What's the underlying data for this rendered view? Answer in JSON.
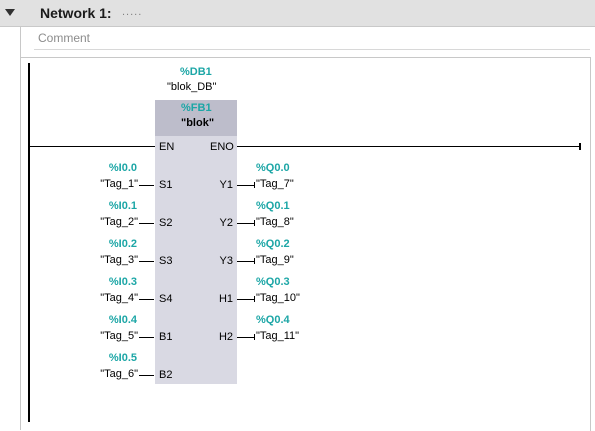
{
  "header": {
    "title": "Network 1:",
    "dots": "....."
  },
  "comment": {
    "placeholder": "Comment"
  },
  "block": {
    "instance_address": "%DB1",
    "instance_name": "\"blok_DB\"",
    "fb_address": "%FB1",
    "fb_name": "\"blok\"",
    "en": "EN",
    "eno": "ENO"
  },
  "inputs": [
    {
      "address": "%I0.0",
      "tag": "\"Tag_1\"",
      "pin": "S1"
    },
    {
      "address": "%I0.1",
      "tag": "\"Tag_2\"",
      "pin": "S2"
    },
    {
      "address": "%I0.2",
      "tag": "\"Tag_3\"",
      "pin": "S3"
    },
    {
      "address": "%I0.3",
      "tag": "\"Tag_4\"",
      "pin": "S4"
    },
    {
      "address": "%I0.4",
      "tag": "\"Tag_5\"",
      "pin": "B1"
    },
    {
      "address": "%I0.5",
      "tag": "\"Tag_6\"",
      "pin": "B2"
    }
  ],
  "outputs": [
    {
      "address": "%Q0.0",
      "tag": "\"Tag_7\"",
      "pin": "Y1"
    },
    {
      "address": "%Q0.1",
      "tag": "\"Tag_8\"",
      "pin": "Y2"
    },
    {
      "address": "%Q0.2",
      "tag": "\"Tag_9\"",
      "pin": "Y3"
    },
    {
      "address": "%Q0.3",
      "tag": "\"Tag_10\"",
      "pin": "H1"
    },
    {
      "address": "%Q0.4",
      "tag": "\"Tag_11\"",
      "pin": "H2"
    }
  ],
  "icons": {
    "collapse": "triangle-down-icon"
  }
}
